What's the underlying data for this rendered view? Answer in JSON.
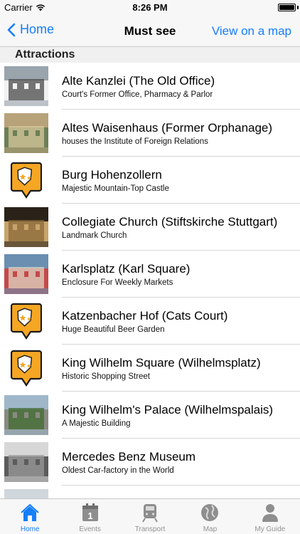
{
  "status_bar": {
    "carrier": "Carrier",
    "time": "8:26 PM"
  },
  "nav": {
    "back_label": "Home",
    "title": "Must see",
    "right_label": "View on a map"
  },
  "section": {
    "header": "Attractions"
  },
  "items": [
    {
      "title": "Alte Kanzlei (The Old Office)",
      "subtitle": "Court's Former Office, Pharmacy & Parlor",
      "thumb": "photo"
    },
    {
      "title": "Altes Waisenhaus (Former Orphanage)",
      "subtitle": "houses the Institute of Foreign Relations",
      "thumb": "photo"
    },
    {
      "title": "Burg Hohenzollern",
      "subtitle": "Majestic Mountain-Top Castle",
      "thumb": "badge"
    },
    {
      "title": "Collegiate Church (Stiftskirche Stuttgart)",
      "subtitle": "Landmark Church",
      "thumb": "photo"
    },
    {
      "title": "Karlsplatz (Karl Square)",
      "subtitle": "Enclosure For Weekly Markets",
      "thumb": "photo"
    },
    {
      "title": "Katzenbacher Hof (Cats Court)",
      "subtitle": "Huge Beautiful Beer Garden",
      "thumb": "badge"
    },
    {
      "title": "King Wilhelm Square (Wilhelmsplatz)",
      "subtitle": "Historic Shopping Street",
      "thumb": "badge"
    },
    {
      "title": "King Wilhelm's Palace (Wilhelmspalais)",
      "subtitle": "A Majestic Building",
      "thumb": "photo"
    },
    {
      "title": "Mercedes Benz Museum",
      "subtitle": "Oldest Car-factory in the World",
      "thumb": "photo"
    },
    {
      "title": "",
      "subtitle": "",
      "thumb": "photo"
    }
  ],
  "tabs": [
    {
      "label": "Home",
      "icon": "home-icon",
      "active": true
    },
    {
      "label": "Events",
      "icon": "calendar-icon",
      "active": false
    },
    {
      "label": "Transport",
      "icon": "train-icon",
      "active": false
    },
    {
      "label": "Map",
      "icon": "globe-icon",
      "active": false
    },
    {
      "label": "My Guide",
      "icon": "person-icon",
      "active": false
    }
  ],
  "colors": {
    "accent": "#157efb",
    "badge_fill": "#f5a623",
    "badge_border": "#1a1a1a",
    "tab_inactive": "#929292"
  }
}
